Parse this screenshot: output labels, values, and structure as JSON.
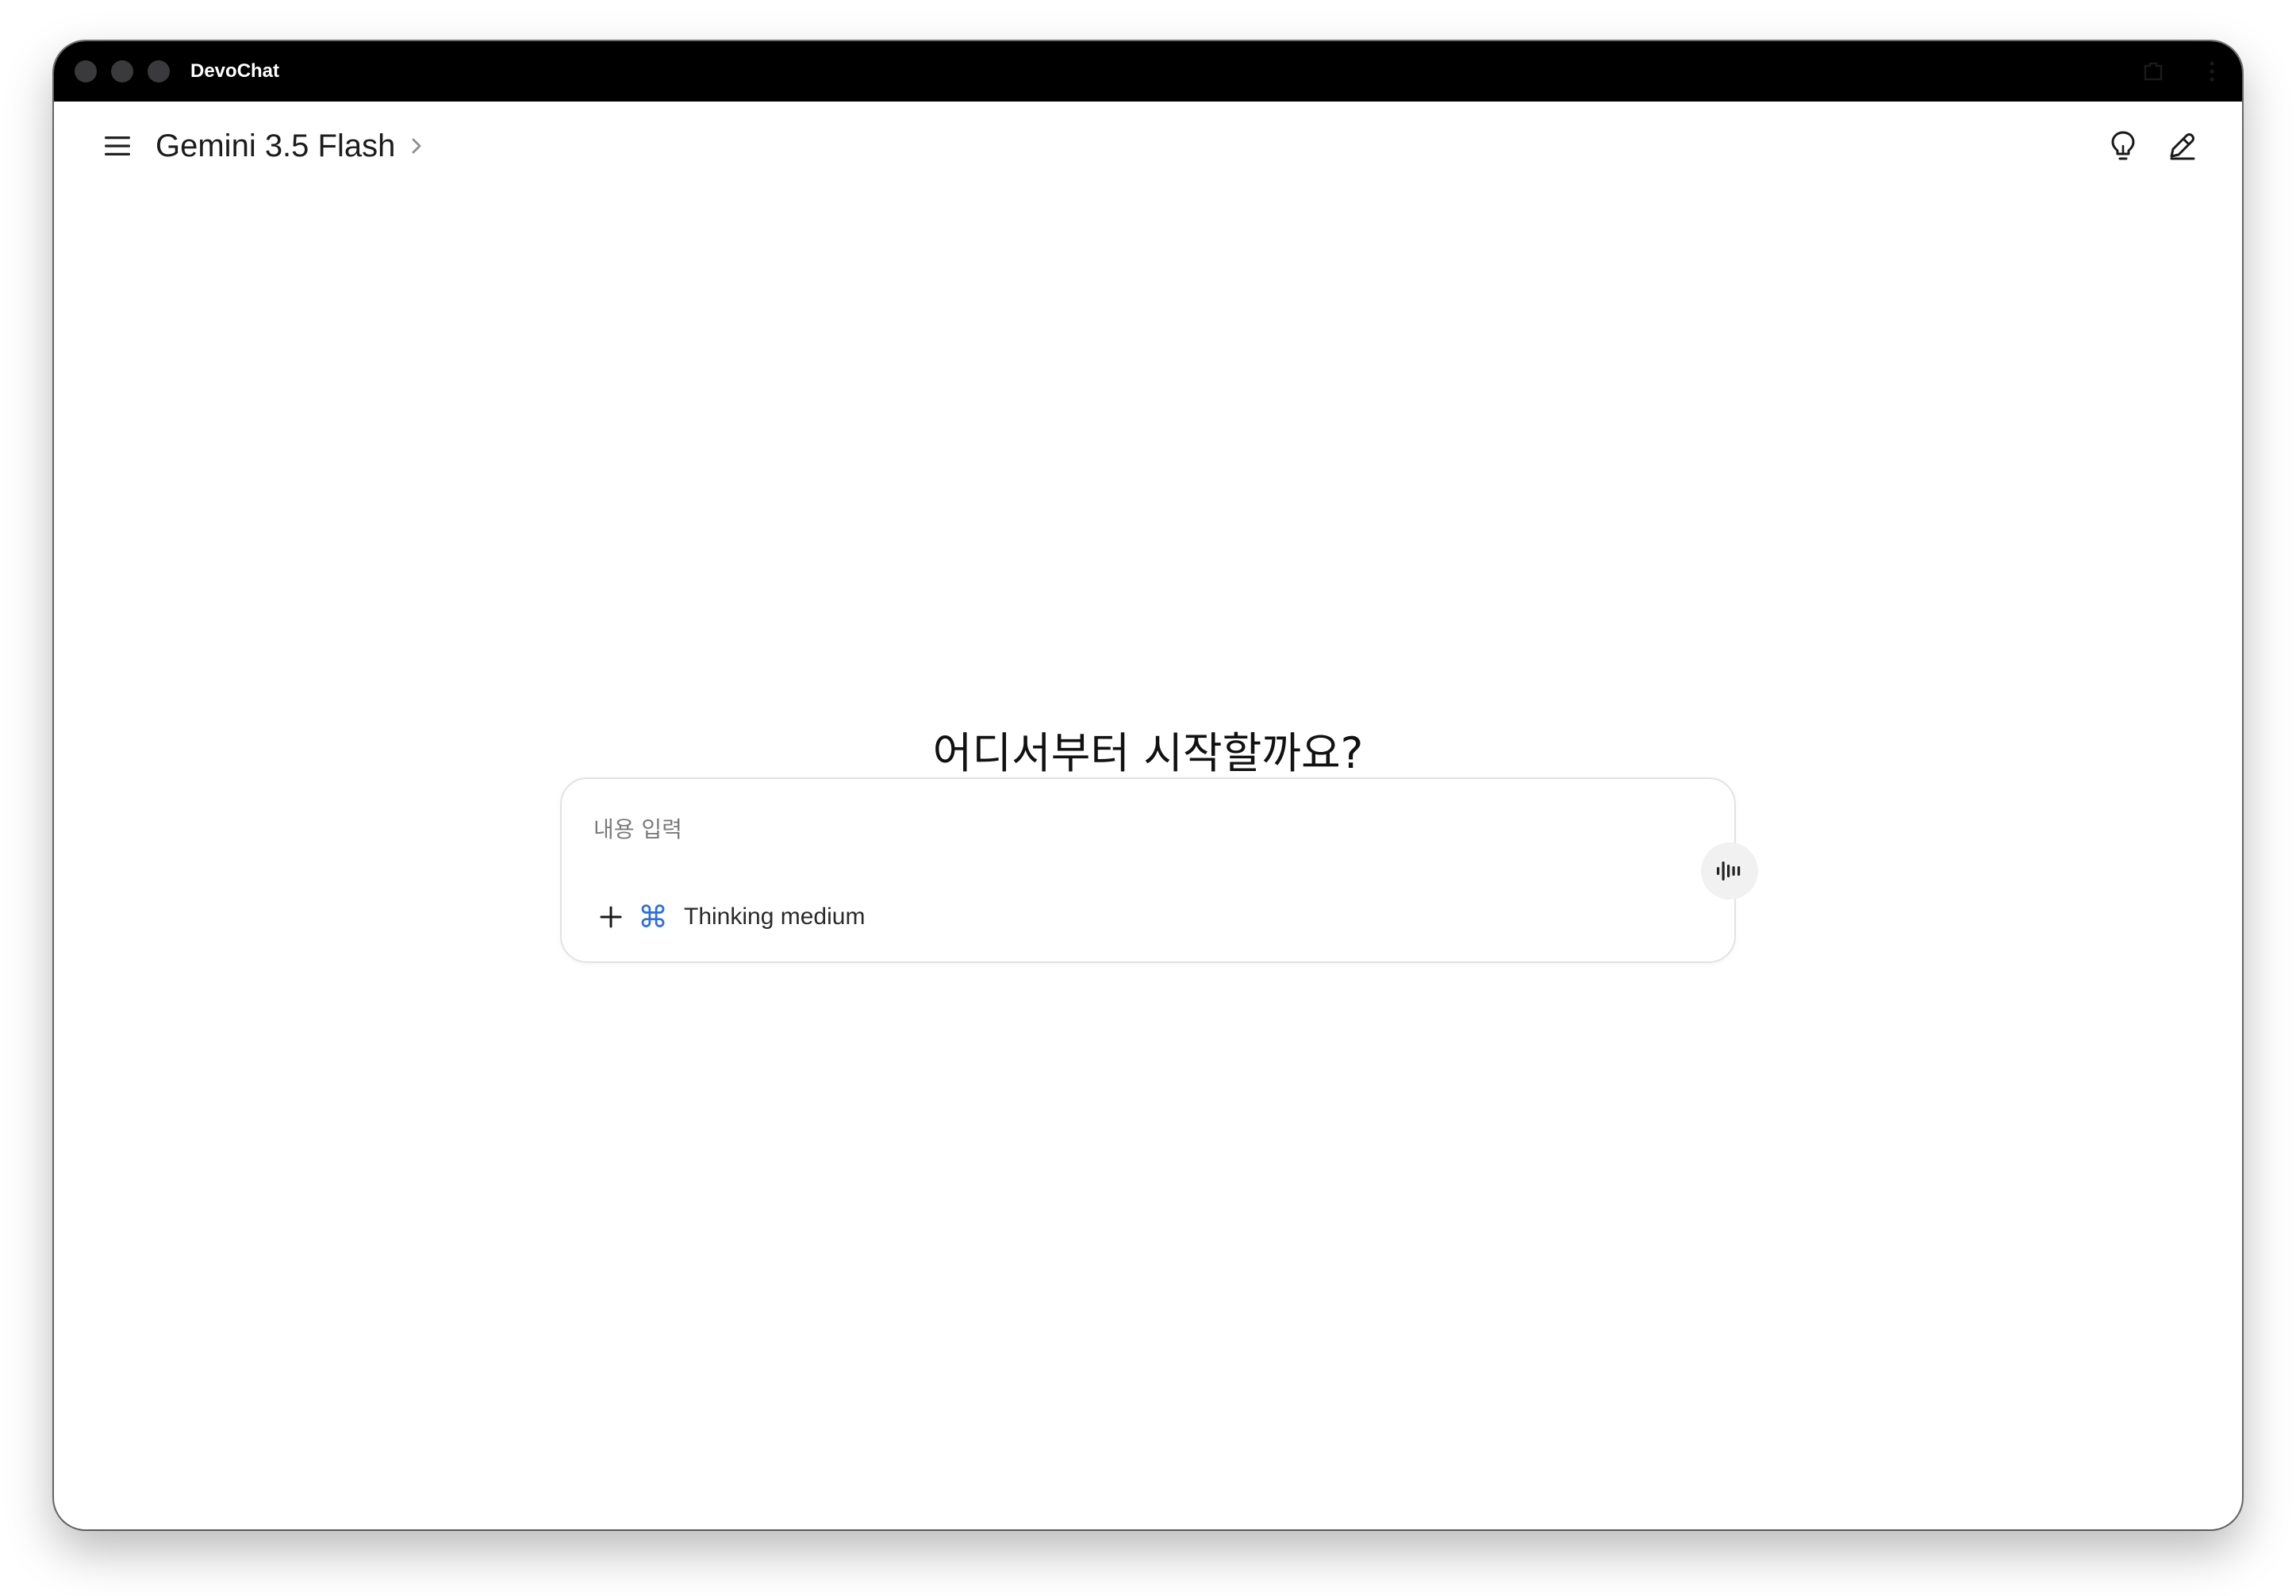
{
  "window": {
    "title": "DevoChat"
  },
  "header": {
    "model_name": "Gemini 3.5 Flash",
    "icons": {
      "menu": "menu-icon",
      "model_chevron": "chevron-right-icon",
      "bulb": "lightbulb-icon",
      "edit": "edit-icon"
    }
  },
  "main": {
    "greeting": "어디서부터 시작할까요?"
  },
  "composer": {
    "placeholder": "내용 입력",
    "value": "",
    "thinking_label": "Thinking medium",
    "command_glyph": "⌘",
    "icons": {
      "add": "plus-icon",
      "voice": "audio-waveform-icon",
      "command": "command-icon"
    }
  },
  "colors": {
    "titlebar": "#000000",
    "accent_blue": "#2d6fe0",
    "text_primary": "#1c1c1e",
    "placeholder": "#7a7a7a",
    "composer_border": "#e3e3e3",
    "voice_button_bg": "#f1f1f1"
  }
}
